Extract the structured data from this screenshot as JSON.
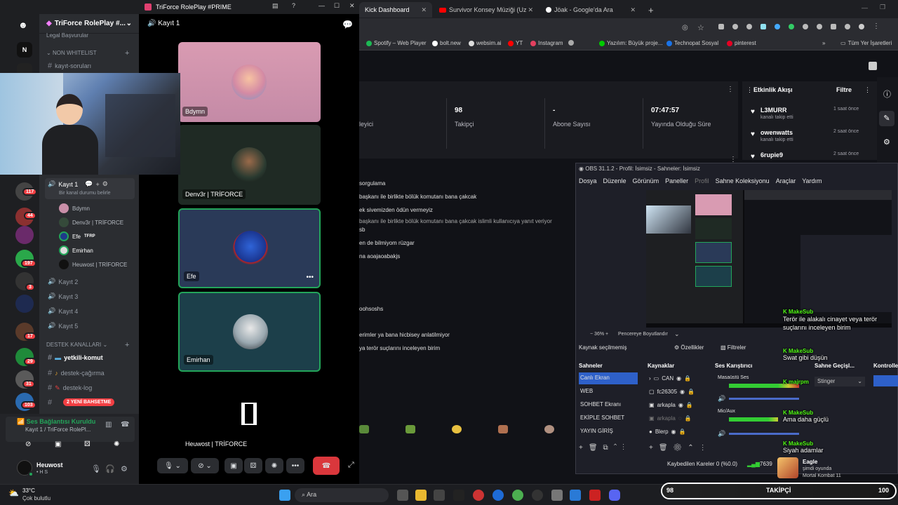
{
  "browser": {
    "tabs": [
      {
        "label": "Kick Dashboard"
      },
      {
        "label": "Survivor Konsey Müziği (Uzun V"
      },
      {
        "label": "Jöak - Google'da Ara"
      }
    ],
    "new_tab": "+",
    "bookmarks": [
      "Spotify – Web Player",
      "bolt.new",
      "websim.ai",
      "YT",
      "Instagram",
      "Yazılım: Büyük proje...",
      "Technopat Sosyal",
      "pinterest"
    ],
    "all_bookmarks": "Tüm Yer İşaretleri"
  },
  "kick": {
    "stats": [
      {
        "value": "",
        "label": "leyici"
      },
      {
        "value": "98",
        "label": "Takipçi"
      },
      {
        "value": "-",
        "label": "Abone Sayısı"
      },
      {
        "value": "07:47:57",
        "label": "Yayında Olduğu Süre"
      }
    ],
    "activity": {
      "title": "Etkinlik Akışı",
      "filter": "Filtre",
      "items": [
        {
          "name": "L3MURR",
          "sub": "kanalı takip etti",
          "time": "1 saat önce"
        },
        {
          "name": "owenwatts",
          "sub": "kanalı takip etti",
          "time": "2 saat önce"
        },
        {
          "name": "6rupie9",
          "sub": "",
          "time": "2 saat önce"
        }
      ]
    },
    "chat": [
      "sorgulama",
      "başkanı ile birlikte bölük komutanı bana çakcak",
      "ek sivemizden ödün vermeyiz",
      "başkanı ile birlikte bölük komutanı bana çakcak islimli kullanıcıya yanıt veriyor",
      "sb",
      "en de bilmiyom rüzgar",
      "na aoajaoabakjs",
      "oohsoshs",
      "erimler ya bana hicbisey anlatilmiyor",
      "ya terör suçlarını inceleyen birim"
    ]
  },
  "discord": {
    "window_title": "TriForce RolePlay #PRIME",
    "server_name": "TriForce RolePlay #...",
    "channels_top": [
      {
        "label": "Legal Başvurular"
      },
      {
        "label": "NON WHITELIST"
      },
      {
        "label": "kayıt-soruları"
      }
    ],
    "voice_channel": "Kayıt 1",
    "voice_status": "Bir kanal durumu belirle",
    "voice_members": [
      {
        "name": "Bdymn"
      },
      {
        "name": "Denv3r | TRİFORCE"
      },
      {
        "name": "Efe",
        "tag": "TFRP"
      },
      {
        "name": "Emirhan"
      },
      {
        "name": "Heuwost | TRİFORCE"
      }
    ],
    "other_voice": [
      "Kayıt 2",
      "Kayıt 3",
      "Kayıt 4",
      "Kayıt 5"
    ],
    "category": "DESTEK KANALLARI",
    "text_channels": [
      "yetkili-komut",
      "destek-çağırma",
      "destek-log"
    ],
    "new_messages": "2 YENİ BAHSETME",
    "connection": {
      "status": "Ses Bağlantısı Kuruldu",
      "location": "Kayıt 1 / TriForce RolePl..."
    },
    "user": {
      "name": "Heuwost",
      "status": "• H S"
    },
    "server_badges": [
      "117",
      "44",
      "197",
      "3",
      "17",
      "29",
      "31",
      "103"
    ],
    "tiles": [
      {
        "name": "Bdymn"
      },
      {
        "name": "Denv3r | TRİFORCE"
      },
      {
        "name": "Efe"
      },
      {
        "name": "Emirhan"
      },
      {
        "name": "Heuwost | TRİFORCE"
      }
    ],
    "header_channel": "Kayıt 1"
  },
  "obs": {
    "title": "OBS 31.1.2 - Profil: İsimsiz - Sahneler: İsimsiz",
    "menu": [
      "Dosya",
      "Düzenle",
      "Görünüm",
      "Paneller",
      "Profil",
      "Sahne Koleksiyonu",
      "Araçlar",
      "Yardım"
    ],
    "zoom": "36%",
    "fit": "Pencereye Boyutlandır",
    "no_source": "Kaynak seçilmemiş",
    "properties": "Özellikler",
    "filters": "Filtreler",
    "docks": [
      "Sahneler",
      "Kaynaklar",
      "Ses Karıştırıcı",
      "Sahne Geçişl...",
      "Kontrolle"
    ],
    "scenes": [
      "Canlı Ekran",
      "WEB",
      "SOHBET Ekranı",
      "EKİPLE SOHBET",
      "YAYIN GİRİŞ"
    ],
    "sources": [
      "CAN",
      "fc26305",
      "arkapla",
      "arkapla",
      "Blerp"
    ],
    "mixer": [
      {
        "label": "Masaüstü Ses"
      },
      {
        "label": "Mic/Aux"
      }
    ],
    "transition": "Stinger",
    "dropped": "Kaybedilen Kareler 0 (%0.0)",
    "fps": "7639"
  },
  "overlays": {
    "makesub": [
      {
        "name": "MakeSub",
        "text": "Terör ile alakalı cinayet veya terör suçlarını inceleyen birim"
      },
      {
        "name": "MakeSub",
        "text": "Swat gibi düşün"
      },
      {
        "name": "majrpm",
        "text": ""
      },
      {
        "name": "MakeSub",
        "text": "Ama daha güçlü"
      },
      {
        "name": "MakeSub",
        "text": "Siyah adamlar"
      }
    ],
    "now_playing": {
      "user": "Eagle",
      "status": "şimdi oyunda",
      "game": "Mortal Kombat 11"
    },
    "follow_bar": {
      "left": "98",
      "label": "TAKİPÇİ",
      "right": "100",
      "progress": 0.98
    }
  },
  "taskbar": {
    "weather_temp": "33°C",
    "weather_desc": "Çok bulutlu",
    "search": "Ara"
  }
}
